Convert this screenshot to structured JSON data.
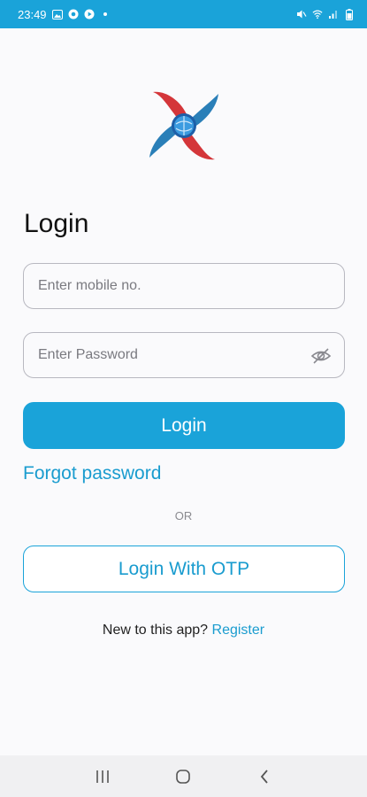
{
  "status_bar": {
    "time": "23:49",
    "left_icons": [
      "image-icon",
      "chrome-icon",
      "play-icon",
      "dot-icon"
    ],
    "right_icons": [
      "mute-icon",
      "wifi-icon",
      "signal-icon",
      "battery-icon"
    ]
  },
  "logo": {
    "icon": "app-logo-icon"
  },
  "title": "Login",
  "mobile": {
    "placeholder": "Enter mobile no.",
    "value": ""
  },
  "password": {
    "placeholder": "Enter Password",
    "value": "",
    "toggle_icon": "eye-off-icon"
  },
  "login_button": "Login",
  "forgot_password": "Forgot password",
  "or_text": "OR",
  "otp_button": "Login With OTP",
  "register": {
    "prompt": "New to this app? ",
    "link": "Register"
  },
  "colors": {
    "accent": "#1aa3d9",
    "link": "#1a9ccf",
    "logo_red": "#d4363a",
    "logo_blue": "#2a7fb8"
  }
}
